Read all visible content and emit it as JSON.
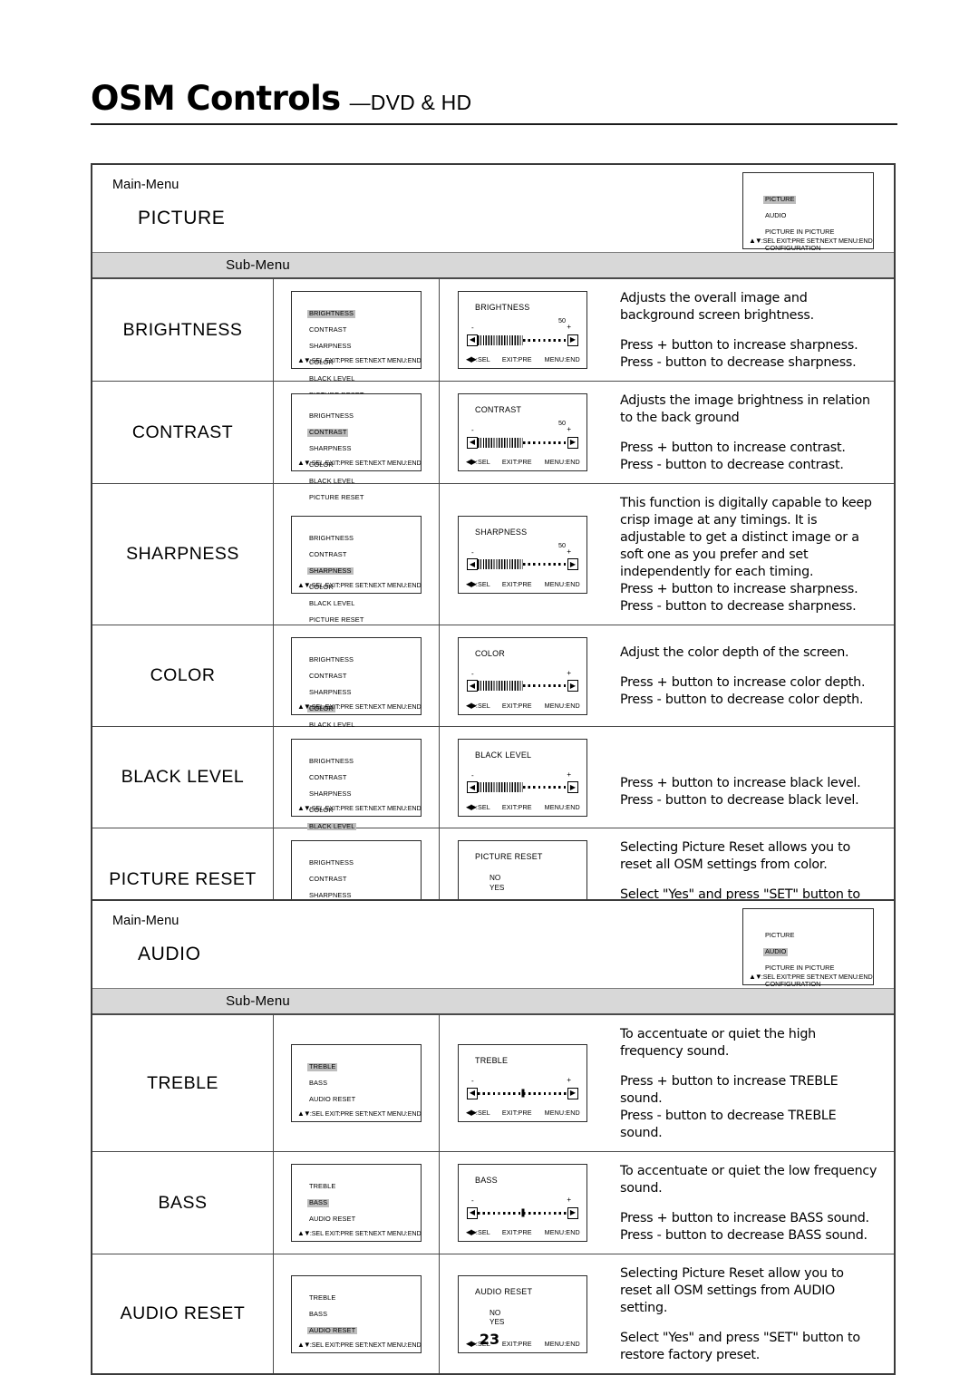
{
  "header": {
    "title_main": "OSM Controls",
    "title_sub": "—DVD & HD"
  },
  "labels": {
    "main_menu": "Main-Menu",
    "sub_menu": "Sub-Menu",
    "osm_foot_list": "▲▼:SEL EXIT:PRE SET:NEXT MENU:END",
    "osm_foot_arrows": "▲▼",
    "osm_foot_text": ":SEL EXIT:PRE SET:NEXT MENU:END",
    "osm_foot_lr": "◀▶",
    "osm_foot_sel": ":SEL",
    "osm_foot_exit": "EXIT:PRE",
    "osm_foot_menu": "MENU:END",
    "minus": "-",
    "plus": "+",
    "left_arrow": "◀",
    "right_arrow": "▶",
    "choice_no": "NO",
    "choice_yes": "YES"
  },
  "main_menu_items": [
    "PICTURE",
    "AUDIO",
    "PICTURE IN PICTURE",
    "CONFIGURATION"
  ],
  "picture_submenu_items": [
    "BRIGHTNESS",
    "CONTRAST",
    "SHARPNESS",
    "COLOR",
    "BLACK LEVEL",
    "PICTURE RESET"
  ],
  "audio_submenu_items": [
    "TREBLE",
    "BASS",
    "AUDIO RESET"
  ],
  "sections": [
    {
      "id": "picture",
      "main_menu_name": "PICTURE",
      "main_menu_selected": 0,
      "rows": [
        {
          "name": "BRIGHTNESS",
          "selected_index": 0,
          "osm_title": "BRIGHTNESS",
          "value": "50",
          "slider": "fill",
          "fill_percent": 50,
          "desc1": "Adjusts the overall image and background screen brightness.",
          "desc2": "Press + button to increase sharpness.",
          "desc3": "Press - button to decrease sharpness."
        },
        {
          "name": "CONTRAST",
          "selected_index": 1,
          "osm_title": "CONTRAST",
          "value": "50",
          "slider": "fill",
          "fill_percent": 50,
          "desc1": "Adjusts the image brightness in relation to the back ground",
          "desc2": "Press + button to increase contrast.",
          "desc3": "Press - button to decrease contrast."
        },
        {
          "name": "SHARPNESS",
          "selected_index": 2,
          "osm_title": "SHARPNESS",
          "value": "50",
          "slider": "fill",
          "fill_percent": 50,
          "desc1": "This function is digitally capable to keep crisp image at any timings.  It is adjustable to get a distinct image or a soft one as you prefer and set independently for each timing.",
          "desc2": "Press + button to increase sharpness.",
          "desc3": "Press - button to decrease sharpness.",
          "no_gap": true
        },
        {
          "name": "COLOR",
          "selected_index": 3,
          "osm_title": "COLOR",
          "value": "",
          "slider": "fill",
          "fill_percent": 50,
          "desc1": "Adjust the color depth  of the screen.",
          "desc2": "Press  + button to increase color depth.",
          "desc3": "Press - button to decrease color depth."
        },
        {
          "name": "BLACK LEVEL",
          "selected_index": 4,
          "osm_title": "BLACK LEVEL",
          "value": "",
          "slider": "fill",
          "fill_percent": 50,
          "desc1": "",
          "desc2": "Press + button to increase black level.",
          "desc3": "Press - button to decrease black level."
        },
        {
          "name": "PICTURE RESET",
          "selected_index": 5,
          "osm_title": "PICTURE RESET",
          "value": "",
          "slider": "choices",
          "desc1": "Selecting Picture Reset allows you to reset all OSM settings from color.",
          "desc2": "Select \"Yes\" and press \"SET\" button to restore to factory preset.",
          "desc3": ""
        }
      ]
    },
    {
      "id": "audio",
      "main_menu_name": "AUDIO",
      "main_menu_selected": 1,
      "rows": [
        {
          "name": "TREBLE",
          "selected_index": 0,
          "osm_title": "TREBLE",
          "value": "",
          "slider": "center",
          "desc1": "To accentuate or quiet the high frequency sound.",
          "desc2": "Press + button to increase TREBLE sound.",
          "desc3": "Press - button to decrease TREBLE sound."
        },
        {
          "name": "BASS",
          "selected_index": 1,
          "osm_title": "BASS",
          "value": "",
          "slider": "center",
          "desc1": "To accentuate or quiet the low frequency sound.",
          "desc2": "Press + button to increase BASS sound.",
          "desc3": "Press - button to decrease BASS sound."
        },
        {
          "name": "AUDIO RESET",
          "selected_index": 2,
          "osm_title": "AUDIO RESET",
          "value": "",
          "slider": "choices",
          "desc1": "Selecting Picture Reset allow you to reset all OSM settings from AUDIO setting.",
          "desc2": "Select \"Yes\" and press \"SET\" button to restore factory preset.",
          "desc3": ""
        }
      ]
    }
  ],
  "footer": {
    "page_number": "23"
  }
}
